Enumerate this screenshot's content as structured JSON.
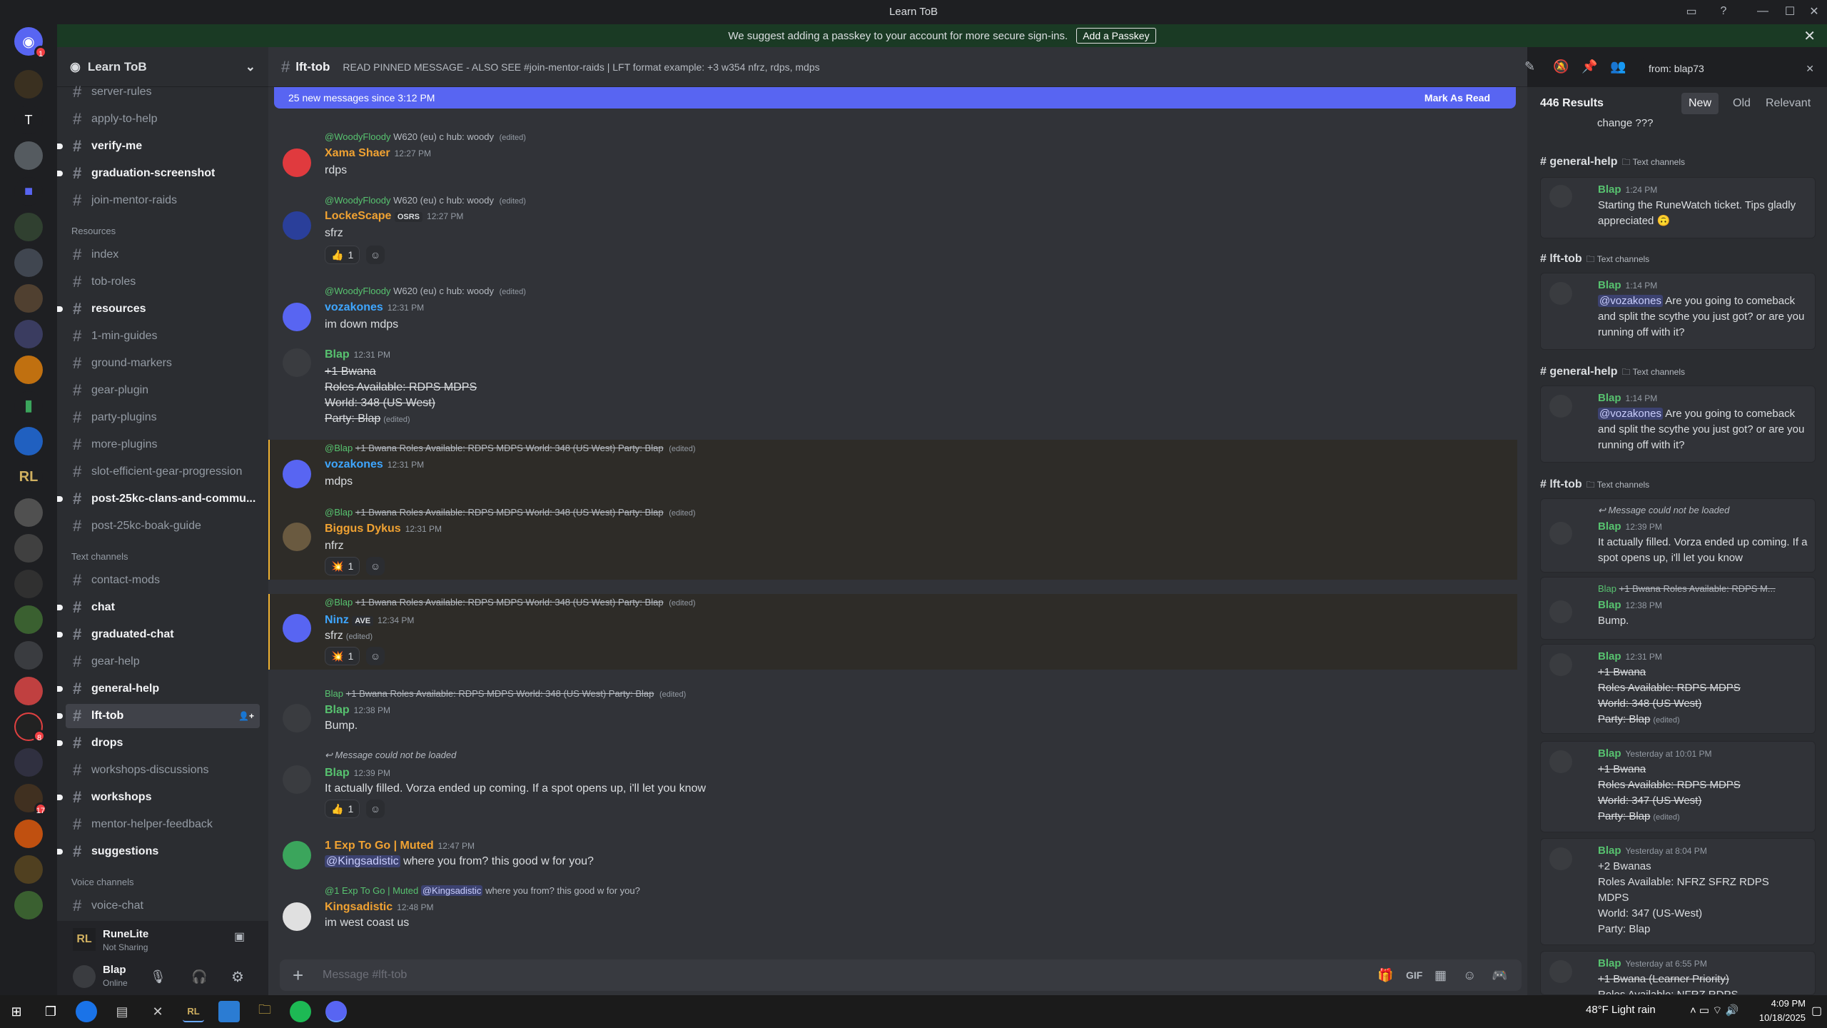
{
  "window": {
    "title": "Learn ToB",
    "controls": [
      "—",
      "☐",
      "✕"
    ]
  },
  "banner": {
    "text": "We suggest adding a passkey to your account for more secure sign-ins.",
    "button": "Add a Passkey"
  },
  "guild": {
    "name": "Learn ToB"
  },
  "channels": [
    {
      "name": "server-rules",
      "style": "muted"
    },
    {
      "name": "apply-to-help",
      "style": "muted"
    },
    {
      "name": "verify-me",
      "style": "bright"
    },
    {
      "name": "graduation-screenshot",
      "style": "bright"
    },
    {
      "name": "join-mentor-raids",
      "style": "muted"
    },
    {
      "category": "Resources"
    },
    {
      "name": "index",
      "style": "muted"
    },
    {
      "name": "tob-roles",
      "style": "muted"
    },
    {
      "name": "resources",
      "style": "bright"
    },
    {
      "name": "1-min-guides",
      "style": "muted"
    },
    {
      "name": "ground-markers",
      "style": "muted"
    },
    {
      "name": "gear-plugin",
      "style": "muted"
    },
    {
      "name": "party-plugins",
      "style": "muted"
    },
    {
      "name": "more-plugins",
      "style": "muted"
    },
    {
      "name": "slot-efficient-gear-progression",
      "style": "muted"
    },
    {
      "name": "post-25kc-clans-and-commu...",
      "style": "bright"
    },
    {
      "name": "post-25kc-boak-guide",
      "style": "muted"
    },
    {
      "category": "Text channels"
    },
    {
      "name": "contact-mods",
      "style": "muted"
    },
    {
      "name": "chat",
      "style": "bright"
    },
    {
      "name": "graduated-chat",
      "style": "bright"
    },
    {
      "name": "gear-help",
      "style": "muted"
    },
    {
      "name": "general-help",
      "style": "bright"
    },
    {
      "name": "lft-tob",
      "style": "active"
    },
    {
      "name": "drops",
      "style": "bright"
    },
    {
      "name": "workshops-discussions",
      "style": "muted"
    },
    {
      "name": "workshops",
      "style": "bright"
    },
    {
      "name": "mentor-helper-feedback",
      "style": "muted"
    },
    {
      "name": "suggestions",
      "style": "bright"
    },
    {
      "category": "Voice channels"
    },
    {
      "name": "voice-chat",
      "style": "muted"
    }
  ],
  "runelite": {
    "title": "RuneLite",
    "sub": "Not Sharing"
  },
  "user": {
    "name": "Blap",
    "status": "Online"
  },
  "header": {
    "channel": "lft-tob",
    "topic": "READ PINNED MESSAGE - ALSO SEE #join-mentor-raids | LFT format example: +3 w354 nfrz, rdps, mdps"
  },
  "newbar": {
    "text": "25 new messages since 3:12 PM",
    "action": "Mark As Read"
  },
  "messages": {
    "m1": {
      "reply_user": "@WoodyFloody",
      "reply_text": "W620 (eu) c hub: woody",
      "name": "Xama Shaer",
      "time": "12:27 PM",
      "text": "rdps"
    },
    "m2": {
      "reply_user": "@WoodyFloody",
      "reply_text": "W620 (eu) c hub: woody",
      "name": "LockeScape",
      "tag": "OSRS",
      "time": "12:27 PM",
      "text": "sfrz",
      "react": "1"
    },
    "m3": {
      "reply_user": "@WoodyFloody",
      "reply_text": "W620 (eu) c hub: woody",
      "name": "vozakones",
      "time": "12:31 PM",
      "text": "im down mdps"
    },
    "m4": {
      "name": "Blap",
      "time": "12:31 PM",
      "lines": [
        "+1 Bwana",
        "Roles Available:   RDPS   MDPS",
        "World: 348 (US West)",
        "Party: Blap"
      ]
    },
    "m5": {
      "reply_user": "@Blap",
      "reply_text": "+1 Bwana Roles Available:   RDPS   MDPS World: 348 (US West) Party: Blap",
      "name": "vozakones",
      "time": "12:31 PM",
      "text": "mdps"
    },
    "m6": {
      "reply_user": "@Blap",
      "reply_text": "+1 Bwana Roles Available:   RDPS   MDPS World: 348 (US West) Party: Blap",
      "name": "Biggus Dykus",
      "time": "12:31 PM",
      "text": "nfrz",
      "react": "1"
    },
    "m7": {
      "reply_user": "@Blap",
      "reply_text": "+1 Bwana Roles Available:   RDPS   MDPS World: 348 (US West) Party: Blap",
      "name": "Ninz",
      "tag": "AVE",
      "time": "12:34 PM",
      "text": "sfrz",
      "react": "1"
    },
    "m8": {
      "reply_user": "Blap",
      "reply_text": "+1 Bwana Roles Available:   RDPS   MDPS World: 348 (US West) Party: Blap",
      "name": "Blap",
      "time": "12:38 PM",
      "text": "Bump."
    },
    "m9": {
      "reply_text": "Message could not be loaded",
      "name": "Blap",
      "time": "12:39 PM",
      "text": "It actually filled. Vorza ended up coming. If a spot opens up, i'll let you know",
      "react": "1"
    },
    "m10": {
      "name": "1 Exp To Go | Muted",
      "time": "12:47 PM",
      "mention": "@Kingsadistic",
      "text": "where you from? this good w for you?"
    },
    "m11": {
      "reply_user": "@1 Exp To Go | Muted",
      "reply_mention": "@Kingsadistic",
      "reply_text": "where you from? this good w for you?",
      "name": "Kingsadistic",
      "time": "12:48 PM",
      "text": "im west coast us"
    }
  },
  "composer": {
    "placeholder": "Message #lft-tob"
  },
  "search": {
    "query": "from: blap73",
    "count": "446 Results",
    "sort": [
      "New",
      "Old",
      "Relevant"
    ],
    "top_fragment": "change ???",
    "groups": [
      {
        "channel": "general-help",
        "cat": "Text channels",
        "name": "Blap",
        "time": "1:24 PM",
        "text": "Starting the RuneWatch ticket. Tips gladly appreciated 🙃"
      },
      {
        "channel": "lft-tob",
        "cat": "Text channels",
        "name": "Blap",
        "time": "1:14 PM",
        "mention": "@vozakones",
        "text": " Are you going to comeback and split the scythe you just got? or are you running off with it?"
      },
      {
        "channel": "general-help",
        "cat": "Text channels",
        "name": "Blap",
        "time": "1:14 PM",
        "mention": "@vozakones",
        "text": " Are you going to comeback and split the scythe you just got? or are you running off with it?"
      },
      {
        "channel": "lft-tob",
        "cat": "Text channels"
      }
    ],
    "r4": {
      "reply": "Message could not be loaded",
      "name": "Blap",
      "time": "12:39 PM",
      "text": "It actually filled. Vorza ended up coming. If a spot opens up, i'll let you know"
    },
    "r5": {
      "reply_user": "Blap",
      "reply_text": "+1 Bwana Roles Available:   RDPS   M...",
      "name": "Blap",
      "time": "12:38 PM",
      "text": "Bump."
    },
    "r6": {
      "name": "Blap",
      "time": "12:31 PM",
      "lines": [
        "+1 Bwana",
        "Roles Available:   RDPS   MDPS",
        "World: 348 (US West)",
        "Party: Blap"
      ]
    },
    "r7": {
      "name": "Blap",
      "time": "Yesterday at 10:01 PM",
      "lines": [
        "+1 Bwana",
        "Roles Available:   RDPS   MDPS",
        "World: 347 (US West)",
        "Party: Blap"
      ]
    },
    "r8": {
      "name": "Blap",
      "time": "Yesterday at 8:04 PM",
      "lines": [
        "+2 Bwanas",
        "Roles Available:   NFRZ   SFRZ   RDPS",
        "MDPS",
        "World: 347 (US-West)",
        "Party: Blap"
      ]
    },
    "r9": {
      "name": "Blap",
      "time": "Yesterday at 6:55 PM",
      "lines": [
        "+1 Bwana (Learner Priority)",
        "Roles Available:   NFRZ   RDPS"
      ]
    }
  },
  "taskbar": {
    "weather": "48°F  Light rain",
    "time": "4:09 PM",
    "date": "10/18/2025"
  },
  "colors": {
    "blurple": "#5865f2",
    "green_name": "#57c26f",
    "orange_name": "#f0a232",
    "blue_name": "#3ea6ff"
  }
}
